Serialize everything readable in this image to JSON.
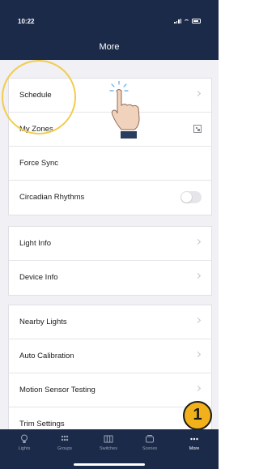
{
  "status_bar": {
    "time": "10:22"
  },
  "header": {
    "title": "More"
  },
  "groups": [
    {
      "rows": [
        {
          "label": "Schedule",
          "accessory": "chevron"
        },
        {
          "label": "My Zones",
          "accessory": "qr-code-icon"
        },
        {
          "label": "Force Sync",
          "accessory": "none"
        },
        {
          "label": "Circadian Rhythms",
          "accessory": "toggle",
          "toggle_on": false
        }
      ]
    },
    {
      "rows": [
        {
          "label": "Light Info",
          "accessory": "chevron"
        },
        {
          "label": "Device Info",
          "accessory": "chevron"
        }
      ]
    },
    {
      "rows": [
        {
          "label": "Nearby Lights",
          "accessory": "chevron"
        },
        {
          "label": "Auto Calibration",
          "accessory": "chevron"
        },
        {
          "label": "Motion Sensor Testing",
          "accessory": "chevron"
        },
        {
          "label": "Trim Settings",
          "accessory": "chevron"
        }
      ]
    }
  ],
  "tabs": [
    {
      "label": "Lights",
      "icon": "bulb-icon"
    },
    {
      "label": "Groups",
      "icon": "groups-icon"
    },
    {
      "label": "Switches",
      "icon": "switch-icon"
    },
    {
      "label": "Scenes",
      "icon": "scenes-icon"
    },
    {
      "label": "More",
      "icon": "more-icon",
      "active": true
    }
  ],
  "annotation": {
    "step_number": "1"
  },
  "colors": {
    "header_bg": "#1c2a49",
    "highlight": "#f2cc4a",
    "badge": "#f2b11a"
  }
}
